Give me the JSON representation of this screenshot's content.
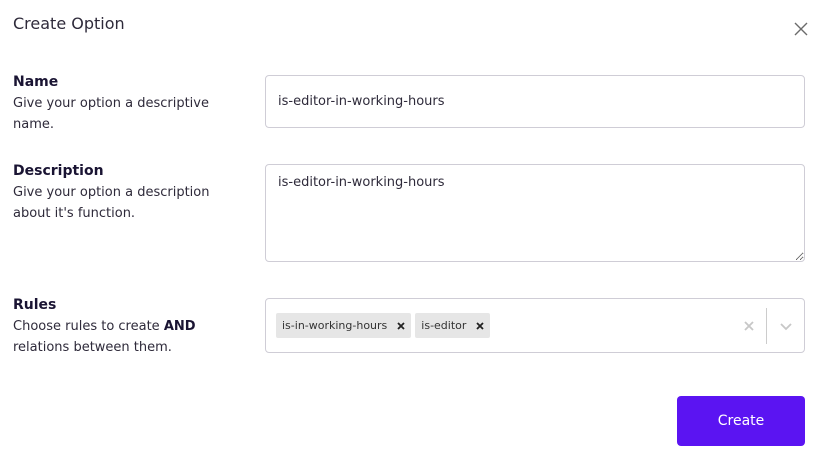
{
  "dialog": {
    "title": "Create Option"
  },
  "name": {
    "label": "Name",
    "help": "Give your option a descriptive name.",
    "value": "is-editor-in-working-hours"
  },
  "description": {
    "label": "Description",
    "help": "Give your option a description about it's function.",
    "value": "is-editor-in-working-hours"
  },
  "rules": {
    "label": "Rules",
    "help_prefix": "Choose rules to create ",
    "help_bold": "AND",
    "help_suffix": " relations between them.",
    "selected": [
      "is-in-working-hours",
      "is-editor"
    ]
  },
  "actions": {
    "create_label": "Create"
  },
  "colors": {
    "accent": "#5b14f2",
    "chip_bg": "#e6e6e6",
    "border": "#cfcdd6"
  },
  "icons": {
    "close": "close-icon",
    "chip_remove": "x-icon",
    "clear": "clear-icon",
    "dropdown": "chevron-down-icon"
  }
}
